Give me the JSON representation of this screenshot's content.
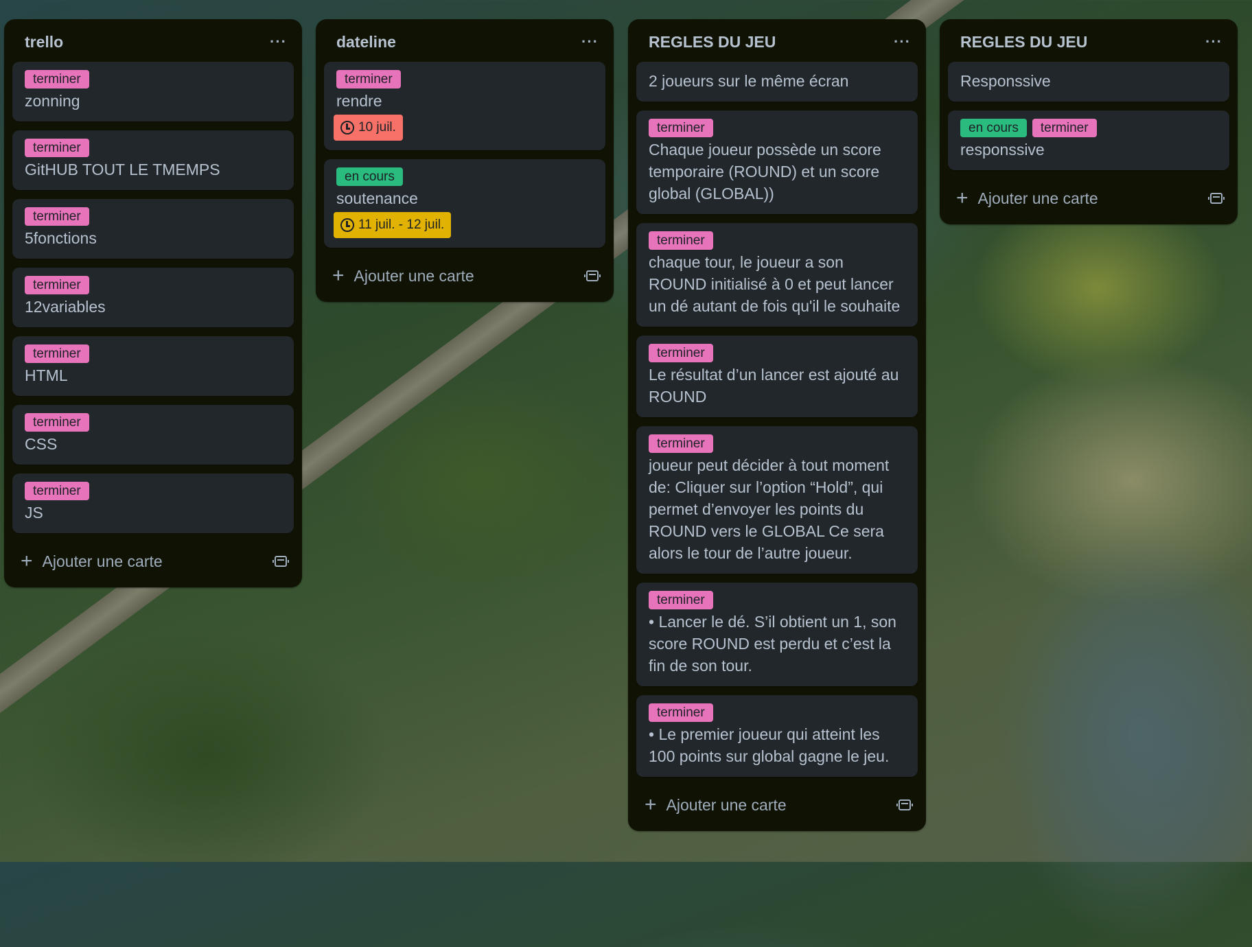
{
  "add_card_label": "Ajouter une carte",
  "lists": [
    {
      "title": "trello",
      "cards": [
        {
          "labels": [
            "terminer"
          ],
          "title": "zonning"
        },
        {
          "labels": [
            "terminer"
          ],
          "title": "GitHUB TOUT LE TMEMPS"
        },
        {
          "labels": [
            "terminer"
          ],
          "title": "5fonctions"
        },
        {
          "labels": [
            "terminer"
          ],
          "title": "12variables"
        },
        {
          "labels": [
            "terminer"
          ],
          "title": "HTML"
        },
        {
          "labels": [
            "terminer"
          ],
          "title": "CSS"
        },
        {
          "labels": [
            "terminer"
          ],
          "title": "JS"
        }
      ]
    },
    {
      "title": "dateline",
      "cards": [
        {
          "labels": [
            "terminer"
          ],
          "title": "rendre",
          "due": "10 juil.",
          "due_status": "overdue"
        },
        {
          "labels": [
            "en cours"
          ],
          "title": "soutenance",
          "due": "11 juil. - 12 juil.",
          "due_status": "due-soon"
        }
      ]
    },
    {
      "title": "REGLES DU JEU",
      "cards": [
        {
          "labels": [],
          "title": "2 joueurs sur le même écran"
        },
        {
          "labels": [
            "terminer"
          ],
          "title": "Chaque joueur possède un score temporaire (ROUND) et un score global (GLOBAL))"
        },
        {
          "labels": [
            "terminer"
          ],
          "title": "chaque tour, le joueur a son ROUND initialisé à 0 et peut lancer un dé autant de fois qu'il le souhaite"
        },
        {
          "labels": [
            "terminer"
          ],
          "title": "Le résultat d’un lancer est ajouté au ROUND"
        },
        {
          "labels": [
            "terminer"
          ],
          "title": "joueur peut décider à tout moment de: Cliquer sur l’option “Hold”, qui permet d’envoyer les points du ROUND vers le GLOBAL Ce sera alors le tour de l’autre joueur."
        },
        {
          "labels": [
            "terminer"
          ],
          "title": "• Lancer le dé. S’il obtient un 1, son score ROUND est perdu et c’est la fin de son tour."
        },
        {
          "labels": [
            "terminer"
          ],
          "title": "• Le premier joueur qui atteint les 100 points sur global gagne le jeu."
        }
      ]
    },
    {
      "title": "REGLES DU JEU",
      "cards": [
        {
          "labels": [],
          "title": "Responssive"
        },
        {
          "labels": [
            "en cours",
            "terminer"
          ],
          "title": "responssive"
        }
      ]
    }
  ],
  "label_colors": {
    "terminer": "#e774bb",
    "en cours": "#2abb7f"
  },
  "due_colors": {
    "overdue": "#f87168",
    "due-soon": "#e2b203"
  },
  "icons": {
    "menu": "ellipsis-icon",
    "add": "plus-icon",
    "template": "card-template-icon",
    "clock": "clock-icon"
  }
}
